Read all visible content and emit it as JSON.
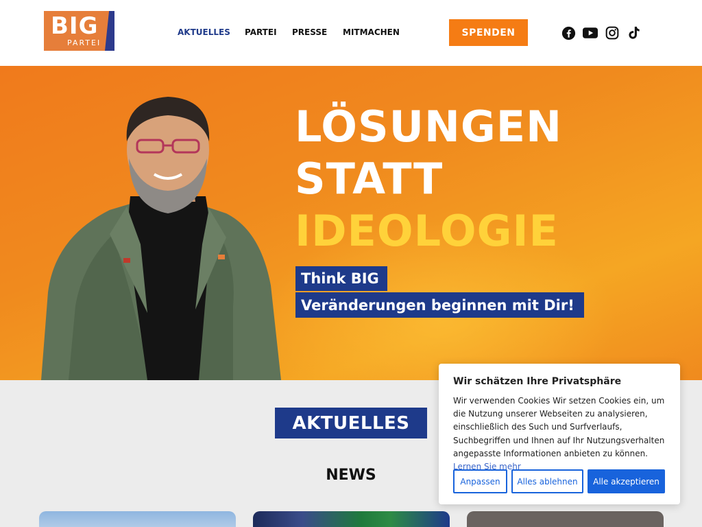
{
  "header": {
    "logo_big": "BIG",
    "logo_partei": "PARTEI",
    "nav": [
      {
        "label": "AKTUELLES",
        "active": true
      },
      {
        "label": "PARTEI",
        "active": false
      },
      {
        "label": "PRESSE",
        "active": false
      },
      {
        "label": "MITMACHEN",
        "active": false
      }
    ],
    "donate_label": "SPENDEN",
    "social_icons": [
      "facebook-icon",
      "youtube-icon",
      "instagram-icon",
      "tiktok-icon"
    ]
  },
  "hero": {
    "headline_line1": "LÖSUNGEN",
    "headline_line2": "STATT",
    "headline_line3": "IDEOLOGIE",
    "tagline1": "Think BIG",
    "tagline2": "Veränderungen beginnen mit Dir!"
  },
  "section": {
    "badge": "AKTUELLES",
    "news_title": "NEWS"
  },
  "cookie": {
    "title": "Wir schätzen Ihre Privatsphäre",
    "text": "Wir verwenden Cookies Wir setzen Cookies ein, um die Nutzung unserer Webseiten zu analysieren, einschließlich des Such und Surfverlaufs, Suchbegriffen und Ihnen auf Ihr Nutzungsverhalten angepasste Informationen anbieten zu können.",
    "link": "Lernen Sie mehr",
    "btn_customize": "Anpassen",
    "btn_reject": "Alles ablehnen",
    "btn_accept": "Alle akzeptieren"
  },
  "colors": {
    "brand_orange": "#f57c14",
    "brand_blue": "#1e3a8a",
    "headline_yellow": "#ffd23a",
    "cookie_blue": "#1863dc"
  }
}
